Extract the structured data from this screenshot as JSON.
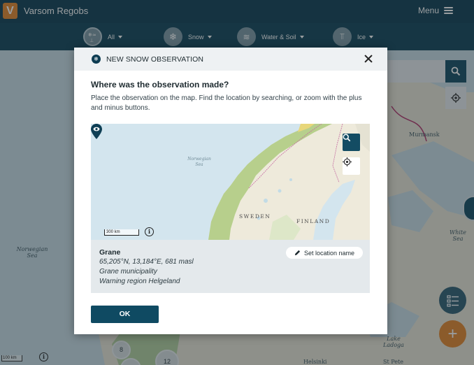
{
  "app": {
    "logo_letter": "V",
    "title": "Varsom Regobs",
    "menu_label": "Menu"
  },
  "filters": [
    {
      "label": "All",
      "icon": "all-observations-icon",
      "active": true
    },
    {
      "label": "Snow",
      "icon": "snowflake-icon",
      "active": false
    },
    {
      "label": "Water & Soil",
      "icon": "water-wave-icon",
      "active": false
    },
    {
      "label": "Ice",
      "icon": "ice-icon",
      "active": false
    }
  ],
  "background_map": {
    "sea_label": "Norwegian\nSea",
    "place_labels": [
      "Murmansk",
      "White\nSea",
      "Lake\nLadoga",
      "Helsinki",
      "St Pete"
    ],
    "clusters": [
      "8",
      "12"
    ],
    "scale_label": "100 km",
    "info_symbol": "i"
  },
  "modal": {
    "title": "NEW SNOW OBSERVATION",
    "question": "Where was the observation made?",
    "instructions": "Place the observation on the map. Find the location by searching, or zoom with the plus and minus buttons.",
    "map": {
      "sea_label": "Norwegian\nSea",
      "countries": [
        "SWEDEN",
        "FINLAND"
      ],
      "scale_label": "300 km",
      "info_symbol": "i"
    },
    "location": {
      "name": "Grane",
      "coordinates": "65,205°N, 13,184°E, 681 masl",
      "municipality": "Grane municipality",
      "warning_region": "Warning region Helgeland",
      "set_name_label": "Set location name"
    },
    "ok_label": "OK"
  },
  "colors": {
    "brand_dark": "#0d3c52",
    "accent_orange": "#e3862b",
    "button": "#0f4a62"
  }
}
